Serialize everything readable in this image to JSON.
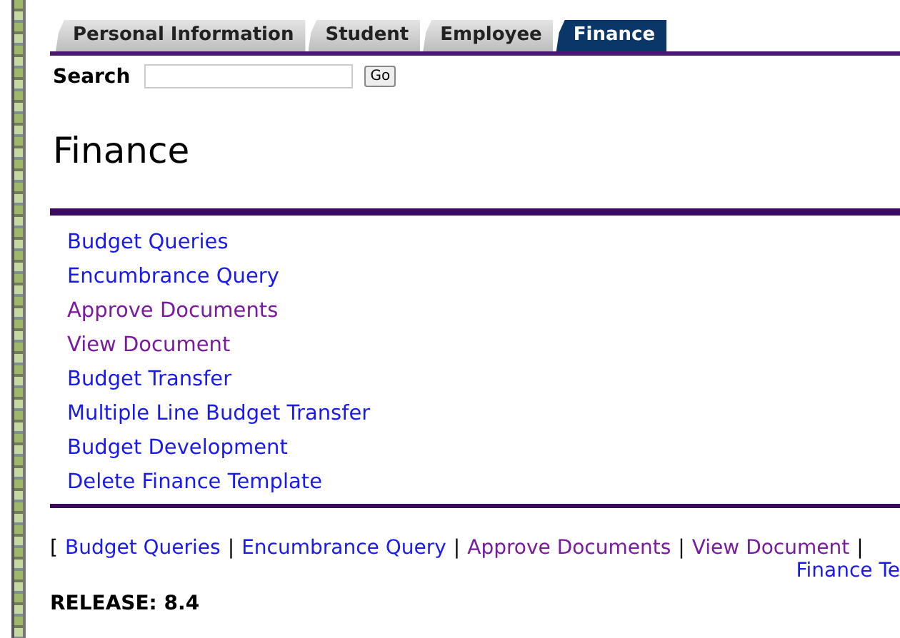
{
  "tabs": [
    {
      "label": "Personal Information",
      "selected": false
    },
    {
      "label": "Student",
      "selected": false
    },
    {
      "label": "Employee",
      "selected": false
    },
    {
      "label": "Finance",
      "selected": true
    }
  ],
  "search": {
    "label": "Search",
    "button": "Go"
  },
  "title": "Finance",
  "menu": [
    {
      "label": "Budget Queries",
      "visited": false
    },
    {
      "label": "Encumbrance Query",
      "visited": false
    },
    {
      "label": "Approve Documents",
      "visited": true
    },
    {
      "label": "View Document",
      "visited": true
    },
    {
      "label": "Budget Transfer",
      "visited": false
    },
    {
      "label": "Multiple Line Budget Transfer",
      "visited": false
    },
    {
      "label": "Budget Development",
      "visited": false
    },
    {
      "label": "Delete Finance Template",
      "visited": false
    }
  ],
  "footer": {
    "open": "[",
    "separator": "|",
    "links": [
      {
        "label": "Budget Queries",
        "visited": false
      },
      {
        "label": "Encumbrance Query",
        "visited": false
      },
      {
        "label": "Approve Documents",
        "visited": true
      },
      {
        "label": "View Document",
        "visited": true
      }
    ],
    "continuation": {
      "label": "Finance Te",
      "visited": false
    }
  },
  "release": "RELEASE: 8.4"
}
